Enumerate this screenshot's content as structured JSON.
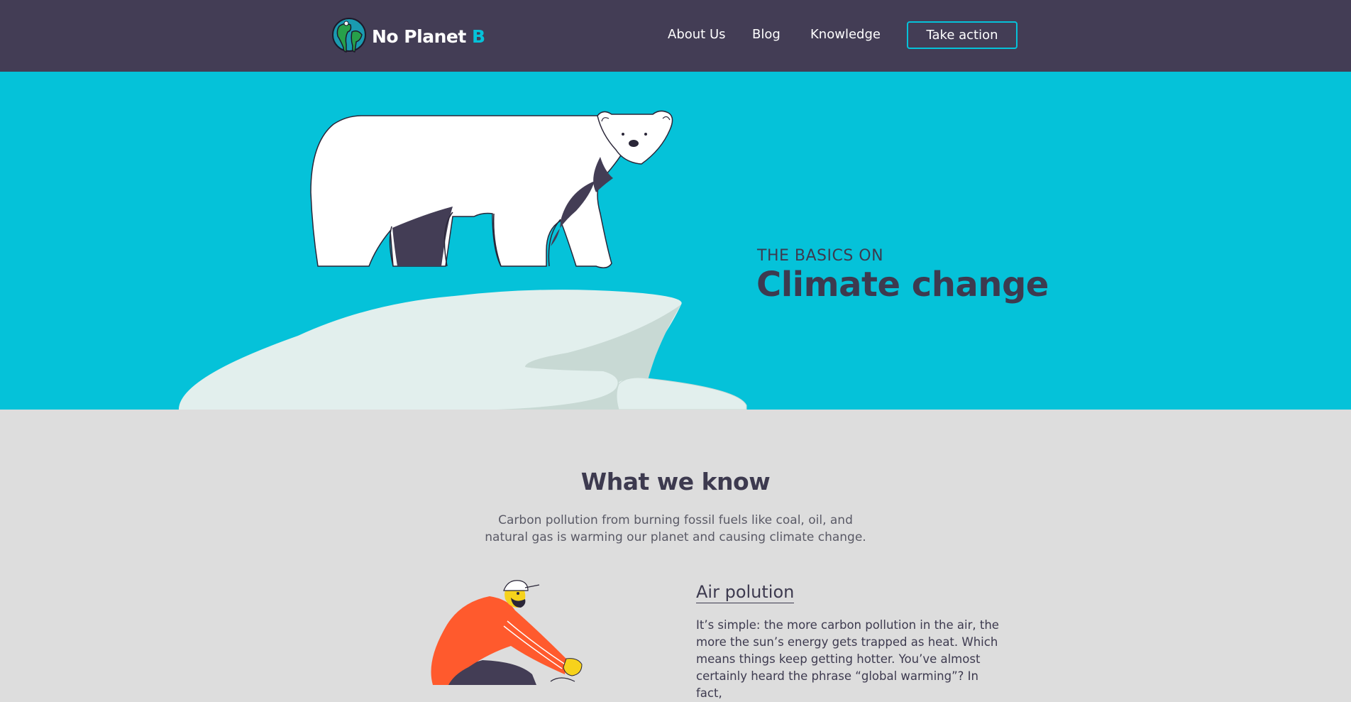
{
  "header": {
    "brand_main": "No Planet",
    "brand_accent": "B",
    "nav": [
      {
        "label": "About Us"
      },
      {
        "label": "Blog"
      },
      {
        "label": "Knowledge"
      }
    ],
    "cta_label": "Take action"
  },
  "hero": {
    "eyebrow": "THE BASICS ON",
    "title": "Climate change"
  },
  "what_we_know": {
    "title": "What we know",
    "subtitle": "Carbon pollution from burning fossil fuels like coal, oil, and natural gas is warming our planet and causing climate change."
  },
  "air_pollution": {
    "title": "Air polution",
    "body": "It’s simple: the more carbon pollution in the air, the more the sun’s energy gets trapped as heat. Which means things keep getting hotter. You’ve almost certainly heard the phrase “global warming”? In fact,"
  },
  "colors": {
    "header_bg": "#433d55",
    "accent": "#05c2d9",
    "text_dark": "#3d3a4f",
    "page_bg": "#dddddd",
    "jacket": "#ff5a2d"
  },
  "icons": [
    "earth-logo-icon",
    "polar-bear-illustration",
    "cyclist-illustration"
  ]
}
